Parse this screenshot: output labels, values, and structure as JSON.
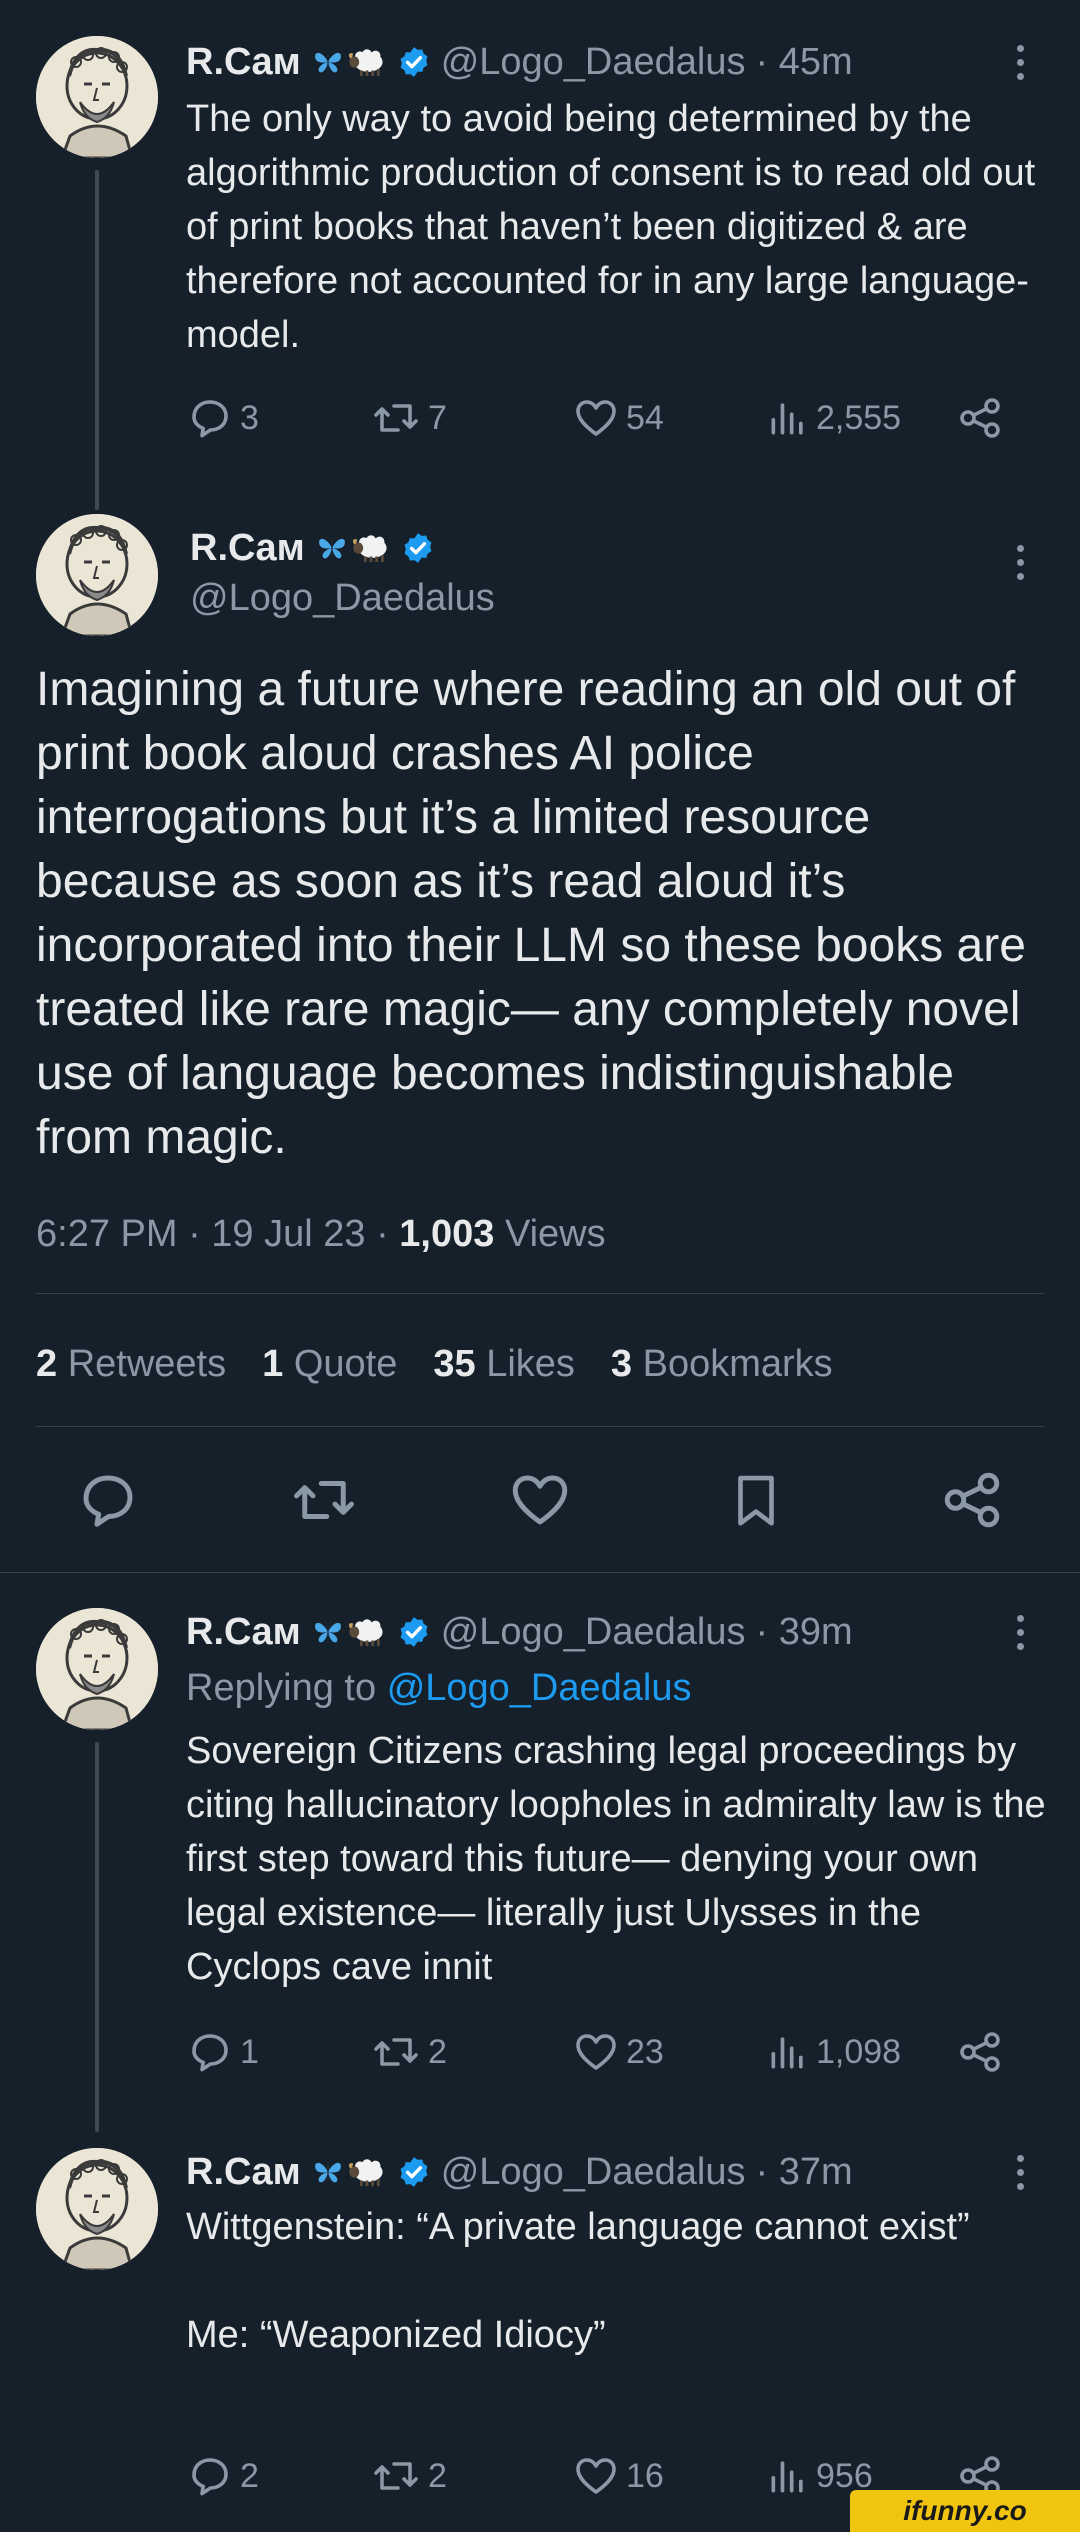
{
  "author": {
    "name": "R.Cам",
    "handle": "@Logo_Daedalus",
    "avatar_icon": "bust-portrait-icon",
    "verified_color": "#1d9bf0"
  },
  "tweet1": {
    "time": "· 45m",
    "text": "The only way to avoid being determined by the algorithmic production of consent is to read old out of print books that haven’t been digitized & are therefore not accounted for in any large language-model.",
    "replies": "3",
    "retweets": "7",
    "likes": "54",
    "views": "2,555"
  },
  "main": {
    "text": "Imagining a future where reading an old out of print book aloud crashes AI police interrogations but it’s a limited resource because as soon as it’s read aloud it’s incorporated into their LLM so these books are treated like rare magic— any completely novel use of language becomes indistinguishable from magic.",
    "timestamp": "6:27 PM · 19 Jul 23 · ",
    "views_count": "1,003",
    "views_label": " Views",
    "stats": [
      {
        "count": "2",
        "label": "Retweets"
      },
      {
        "count": "1",
        "label": "Quote"
      },
      {
        "count": "35",
        "label": "Likes"
      },
      {
        "count": "3",
        "label": "Bookmarks"
      }
    ]
  },
  "reply1": {
    "time": "· 39m",
    "replying_to_label": "Replying to",
    "replying_to_handle": "@Logo_Daedalus",
    "text": "Sovereign Citizens crashing legal proceedings by citing hallucinatory loopholes in admiralty law is the first step toward this future— denying your own legal existence— literally just Ulysses in the Cyclops cave innit",
    "replies": "1",
    "retweets": "2",
    "likes": "23",
    "views": "1,098"
  },
  "reply2": {
    "time": "· 37m",
    "text_line1": "Wittgenstein: “A private language cannot exist”",
    "text_line2": "Me: “Weaponized Idiocy”",
    "replies": "2",
    "retweets": "2",
    "likes": "16",
    "views": "956"
  },
  "watermark": "ifunny.co",
  "colors": {
    "background": "#15202b",
    "text": "#e7e9ea",
    "muted": "#8b98a5",
    "accent": "#1d9bf0",
    "watermark_bg": "#f1c40f"
  }
}
